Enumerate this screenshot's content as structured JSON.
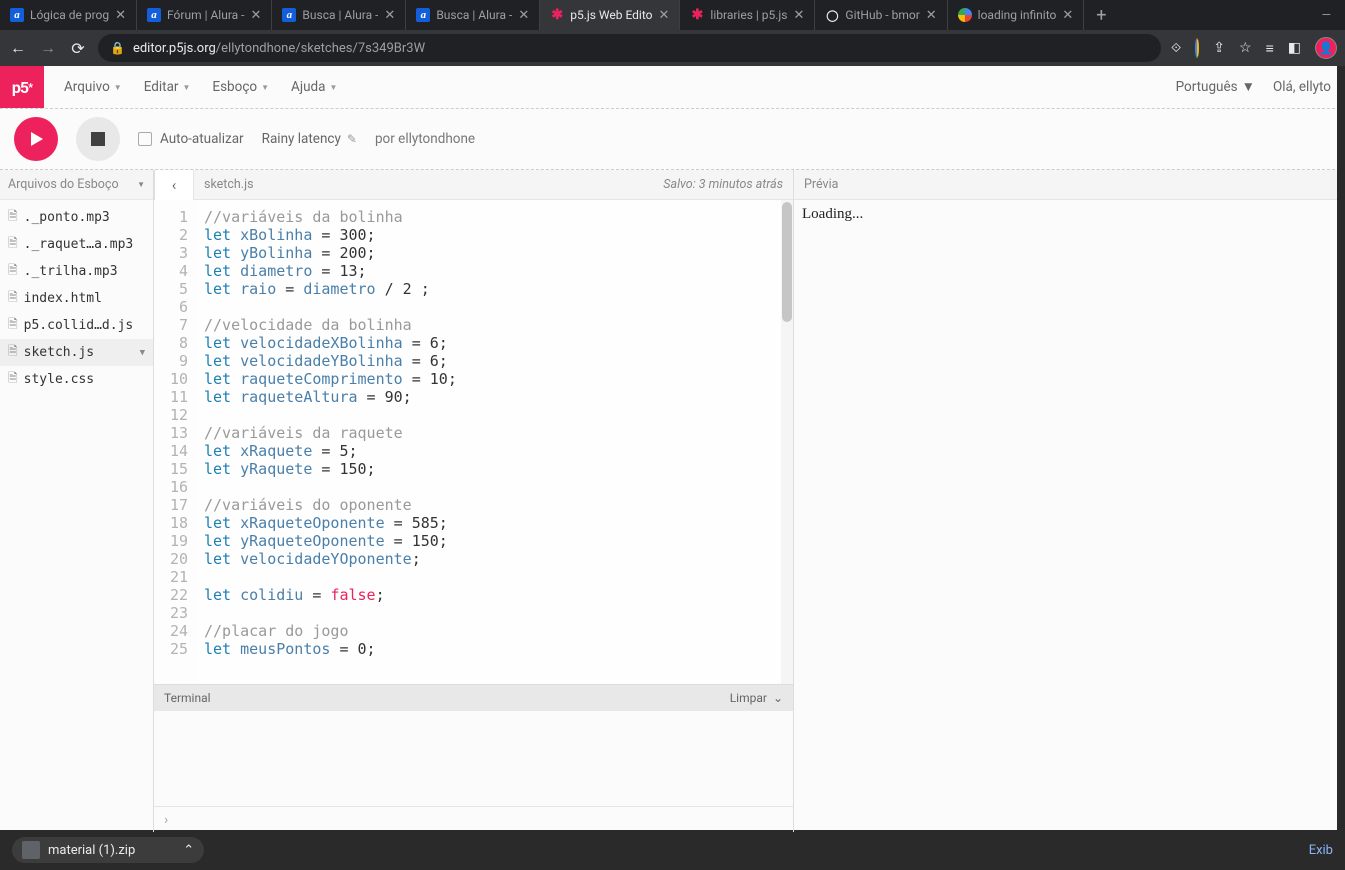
{
  "browser": {
    "tabs": [
      {
        "title": "Lógica de prog",
        "fav": "alura"
      },
      {
        "title": "Fórum | Alura -",
        "fav": "alura"
      },
      {
        "title": "Busca | Alura -",
        "fav": "alura"
      },
      {
        "title": "Busca | Alura -",
        "fav": "alura"
      },
      {
        "title": "p5.js Web Edito",
        "fav": "p5",
        "active": true
      },
      {
        "title": "libraries | p5.js",
        "fav": "p5"
      },
      {
        "title": "GitHub - bmor",
        "fav": "gh"
      },
      {
        "title": "loading infinito",
        "fav": "goog"
      }
    ],
    "url_host": "editor.p5js.org",
    "url_path": "/ellytondhone/sketches/7s349Br3W"
  },
  "topbar": {
    "menus": [
      "Arquivo",
      "Editar",
      "Esboço",
      "Ajuda"
    ],
    "language": "Português",
    "greeting": "Olá, ellyto"
  },
  "toolbar": {
    "auto_label": "Auto-atualizar",
    "sketch_name": "Rainy latency",
    "author_prefix": "por",
    "author": "ellytondhone"
  },
  "sidebar": {
    "title": "Arquivos do Esboço",
    "files": [
      {
        "name": "._ponto.mp3"
      },
      {
        "name": "._raquet…a.mp3"
      },
      {
        "name": "._trilha.mp3"
      },
      {
        "name": "index.html"
      },
      {
        "name": "p5.collid…d.js"
      },
      {
        "name": "sketch.js",
        "active": true
      },
      {
        "name": "style.css"
      }
    ]
  },
  "editor": {
    "filename": "sketch.js",
    "saved": "Salvo: 3 minutos atrás",
    "lines": [
      {
        "n": 1,
        "t": "comment",
        "text": "//variáveis da bolinha"
      },
      {
        "n": 2,
        "t": "let",
        "var": "xBolinha",
        "rest": " = 300;"
      },
      {
        "n": 3,
        "t": "let",
        "var": "yBolinha",
        "rest": " = 200;"
      },
      {
        "n": 4,
        "t": "let",
        "var": "diametro",
        "rest": " = 13;"
      },
      {
        "n": 5,
        "t": "letvar",
        "var": "raio",
        "mid": " = ",
        "var2": "diametro",
        "rest": " / 2 ;"
      },
      {
        "n": 6,
        "t": "blank"
      },
      {
        "n": 7,
        "t": "comment",
        "text": "//velocidade da bolinha"
      },
      {
        "n": 8,
        "t": "let",
        "var": "velocidadeXBolinha",
        "rest": " = 6;"
      },
      {
        "n": 9,
        "t": "let",
        "var": "velocidadeYBolinha",
        "rest": " = 6;"
      },
      {
        "n": 10,
        "t": "let",
        "var": "raqueteComprimento",
        "rest": " = 10;"
      },
      {
        "n": 11,
        "t": "let",
        "var": "raqueteAltura",
        "rest": " = 90;"
      },
      {
        "n": 12,
        "t": "blank"
      },
      {
        "n": 13,
        "t": "comment",
        "text": "//variáveis da raquete"
      },
      {
        "n": 14,
        "t": "let",
        "var": "xRaquete",
        "rest": " = 5;"
      },
      {
        "n": 15,
        "t": "let",
        "var": "yRaquete",
        "rest": " = 150;"
      },
      {
        "n": 16,
        "t": "blank"
      },
      {
        "n": 17,
        "t": "comment",
        "text": "//variáveis do oponente"
      },
      {
        "n": 18,
        "t": "let",
        "var": "xRaqueteOponente",
        "rest": " = 585;"
      },
      {
        "n": 19,
        "t": "let",
        "var": "yRaqueteOponente",
        "rest": " = 150;"
      },
      {
        "n": 20,
        "t": "letnone",
        "var": "velocidadeYOponente",
        "rest": ";"
      },
      {
        "n": 21,
        "t": "blank"
      },
      {
        "n": 22,
        "t": "letbool",
        "var": "colidiu",
        "mid": " = ",
        "bool": "false",
        "rest": ";"
      },
      {
        "n": 23,
        "t": "blank"
      },
      {
        "n": 24,
        "t": "comment",
        "text": "//placar do jogo"
      },
      {
        "n": 25,
        "t": "let",
        "var": "meusPontos",
        "rest": " = 0;"
      }
    ]
  },
  "console": {
    "title": "Terminal",
    "clear": "Limpar",
    "prompt": "›"
  },
  "preview": {
    "title": "Prévia",
    "body": "Loading..."
  },
  "download": {
    "file": "material (1).zip",
    "show": "Exib"
  }
}
